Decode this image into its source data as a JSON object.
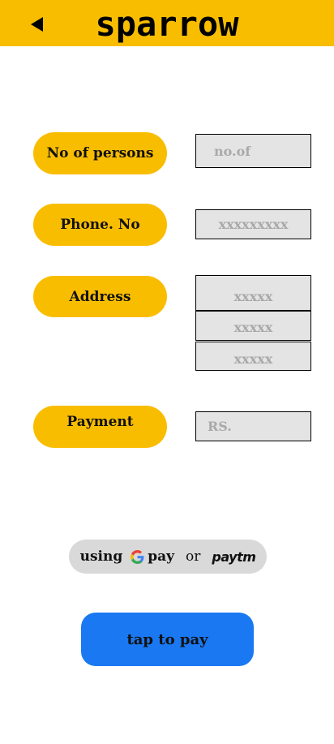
{
  "header": {
    "title": "sparrow",
    "back_icon": "back-arrow-icon",
    "color": "#f9bd00"
  },
  "form": {
    "persons": {
      "label": "No of persons",
      "placeholder": "no.of"
    },
    "phone": {
      "label": "Phone. No",
      "placeholder": "xxxxxxxxx"
    },
    "address": {
      "label": "Address",
      "placeholders": [
        "xxxxx",
        "xxxxx",
        "xxxxx"
      ]
    },
    "payment": {
      "label": "Payment",
      "placeholder": "RS."
    }
  },
  "payment_options": {
    "prefix": "using",
    "gpay": "pay",
    "separator": "or",
    "paytm": "paytm"
  },
  "pay_button": {
    "label": "tap to pay",
    "color": "#1a78f2"
  }
}
